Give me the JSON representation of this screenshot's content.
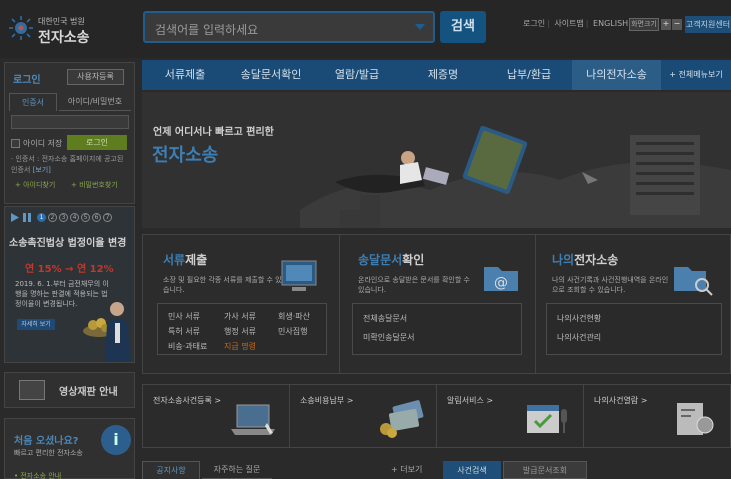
{
  "header": {
    "logo_sub": "대한민국 법원",
    "logo_main": "전자소송",
    "search_placeholder": "검색어를 입력하세요",
    "search_button": "검색",
    "top_links": [
      "로그인",
      "사이트맵",
      "ENGLISH"
    ],
    "zoom_label": "화면크기",
    "zoom_in": "+",
    "zoom_out": "−",
    "support_button": "고객지원센터"
  },
  "nav": {
    "items": [
      "서류제출",
      "송달문서확인",
      "열람/발급",
      "제증명",
      "납부/환급",
      "나의전자소송"
    ],
    "active_index": 5,
    "all_menu": "+ 전체메뉴보기"
  },
  "login": {
    "title": "로그인",
    "signup": "사용자등록",
    "tab_cert": "인증서",
    "tab_id": "아이디/비밀번호",
    "save_id": "아이디 저장",
    "login_button": "로그인",
    "note": "· 인증서 : 전자소송 홈페이지에 공고된 인증서",
    "note_link": "[보기]",
    "find_id": "+ 아이디찾기",
    "find_pw": "+ 비밀번호찾기"
  },
  "rate_banner": {
    "pages": [
      "1",
      "2",
      "3",
      "4",
      "5",
      "6",
      "7"
    ],
    "active_page": 0,
    "title": "소송촉진법상 법정이율 변경",
    "from": "연 15%",
    "arrow": "→",
    "to": "연 12%",
    "desc": "2019. 6. 1.부터 금전채무의 이행을 명하는 판결에 적용되는 법정이율이 변경됩니다.",
    "more": "자세히 보기"
  },
  "video": {
    "label": "영상재판 안내"
  },
  "welcome": {
    "title": "처음 오셨나요?",
    "sub": "빠르고 편리한 전자소송",
    "link": "• 전자소송 안내",
    "icon": "i"
  },
  "hero": {
    "subtitle": "언제 어디서나 빠르고 편리한",
    "title": "전자소송"
  },
  "services": [
    {
      "title_blue": "서류",
      "title_rest": "제출",
      "desc": "소장 및 필요한 각종 서류를 제출할 수 있습니다.",
      "items": [
        "민사 서류",
        "가사 서류",
        "회생·파산",
        "특허 서류",
        "행정 서류",
        "민사집행",
        "비송·과태료",
        "지급 명령"
      ]
    },
    {
      "title_blue": "송달문서",
      "title_rest": "확인",
      "desc": "온라인으로 송달받은 문서를 확인할 수 있습니다.",
      "items": [
        "전체송달문서",
        "미확인송달문서"
      ]
    },
    {
      "title_blue": "나의",
      "title_rest": "전자소송",
      "desc": "나의 사건기록과 사건진행내역을 온라인으로 조회할 수 있습니다.",
      "items": [
        "나의사건현황",
        "나의사건관리"
      ]
    }
  ],
  "quick": [
    "전자소송사건등록 >",
    "소송비용납부 >",
    "알림서비스 >",
    "나의사건열람 >"
  ],
  "bottom": {
    "tab_notice": "공지사항",
    "tab_faq": "자주하는 질문",
    "more": "+ 더보기",
    "tab_case": "사건검색",
    "tab_issue": "발급문서조회"
  },
  "colors": {
    "brand_blue": "#1a4b76",
    "accent_green": "#5d7d1f",
    "highlight_orange": "#c66a12"
  }
}
